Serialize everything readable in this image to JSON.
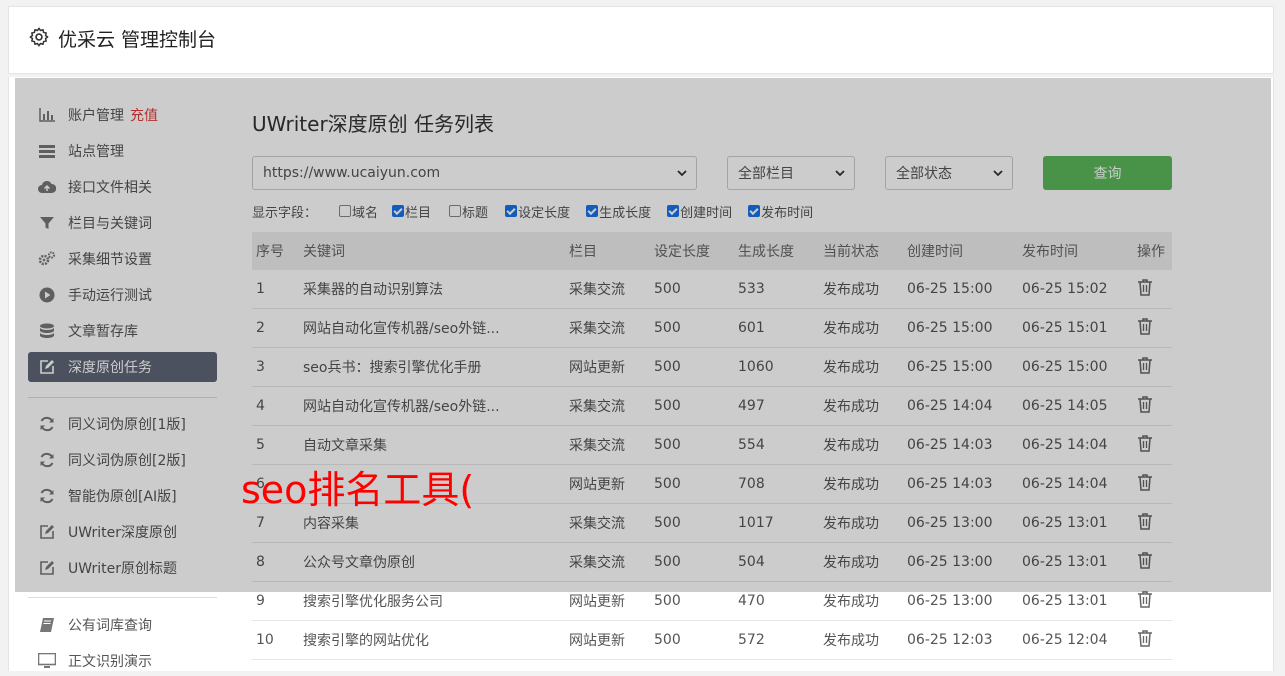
{
  "header": {
    "title": "优采云 管理控制台",
    "icon": "gear-icon"
  },
  "sidebar": {
    "group1": [
      {
        "label": "账户管理",
        "badge": "充值",
        "icon": "chart-icon"
      },
      {
        "label": "站点管理",
        "icon": "server-icon"
      },
      {
        "label": "接口文件相关",
        "icon": "cloud-upload-icon"
      },
      {
        "label": "栏目与关键词",
        "icon": "filter-icon"
      },
      {
        "label": "采集细节设置",
        "icon": "cogs-icon"
      },
      {
        "label": "手动运行测试",
        "icon": "play-icon"
      },
      {
        "label": "文章暂存库",
        "icon": "database-icon"
      },
      {
        "label": "深度原创任务",
        "icon": "edit-icon",
        "active": true
      }
    ],
    "group2": [
      {
        "label": "同义词伪原创[1版]",
        "icon": "refresh-icon"
      },
      {
        "label": "同义词伪原创[2版]",
        "icon": "refresh-icon"
      },
      {
        "label": "智能伪原创[AI版]",
        "icon": "refresh-icon"
      },
      {
        "label": "UWriter深度原创",
        "icon": "edit-icon"
      },
      {
        "label": "UWriter原创标题",
        "icon": "edit-icon"
      }
    ],
    "group3": [
      {
        "label": "公有词库查询",
        "icon": "book-icon"
      },
      {
        "label": "正文识别演示",
        "icon": "monitor-icon"
      }
    ]
  },
  "main": {
    "title": "UWriter深度原创 任务列表",
    "site_select": "https://www.ucaiyun.com",
    "column_select": "全部栏目",
    "status_select": "全部状态",
    "query_label": "查询",
    "fields_label": "显示字段：",
    "fields": [
      {
        "label": "域名",
        "checked": false
      },
      {
        "label": "栏目",
        "checked": true
      },
      {
        "label": "标题",
        "checked": false
      },
      {
        "label": "设定长度",
        "checked": true
      },
      {
        "label": "生成长度",
        "checked": true
      },
      {
        "label": "创建时间",
        "checked": true
      },
      {
        "label": "发布时间",
        "checked": true
      }
    ],
    "columns": [
      "序号",
      "关键词",
      "栏目",
      "设定长度",
      "生成长度",
      "当前状态",
      "创建时间",
      "发布时间",
      "操作"
    ],
    "rows": [
      [
        "1",
        "采集器的自动识别算法",
        "采集交流",
        "500",
        "533",
        "发布成功",
        "06-25 15:00",
        "06-25 15:02"
      ],
      [
        "2",
        "网站自动化宣传机器/seo外链...",
        "采集交流",
        "500",
        "601",
        "发布成功",
        "06-25 15:00",
        "06-25 15:01"
      ],
      [
        "3",
        "seo兵书：搜索引擎优化手册",
        "网站更新",
        "500",
        "1060",
        "发布成功",
        "06-25 15:00",
        "06-25 15:00"
      ],
      [
        "4",
        "网站自动化宣传机器/seo外链...",
        "采集交流",
        "500",
        "497",
        "发布成功",
        "06-25 14:04",
        "06-25 14:05"
      ],
      [
        "5",
        "自动文章采集",
        "采集交流",
        "500",
        "554",
        "发布成功",
        "06-25 14:03",
        "06-25 14:04"
      ],
      [
        "6",
        "",
        "网站更新",
        "500",
        "708",
        "发布成功",
        "06-25 14:03",
        "06-25 14:04"
      ],
      [
        "7",
        "内容采集",
        "采集交流",
        "500",
        "1017",
        "发布成功",
        "06-25 13:00",
        "06-25 13:01"
      ],
      [
        "8",
        "公众号文章伪原创",
        "采集交流",
        "500",
        "504",
        "发布成功",
        "06-25 13:00",
        "06-25 13:01"
      ],
      [
        "9",
        "搜索引擎优化服务公司",
        "网站更新",
        "500",
        "470",
        "发布成功",
        "06-25 13:00",
        "06-25 13:01"
      ],
      [
        "10",
        "搜索引擎的网站优化",
        "网站更新",
        "500",
        "572",
        "发布成功",
        "06-25 12:03",
        "06-25 12:04"
      ]
    ]
  },
  "overlay_text": "seo排名工具(",
  "colors": {
    "success": "#2e8b2e",
    "accent": "#5cb85c",
    "recharge": "#e03c3c",
    "active_bg": "#5e6677",
    "overlay_text": "#ff0000"
  }
}
